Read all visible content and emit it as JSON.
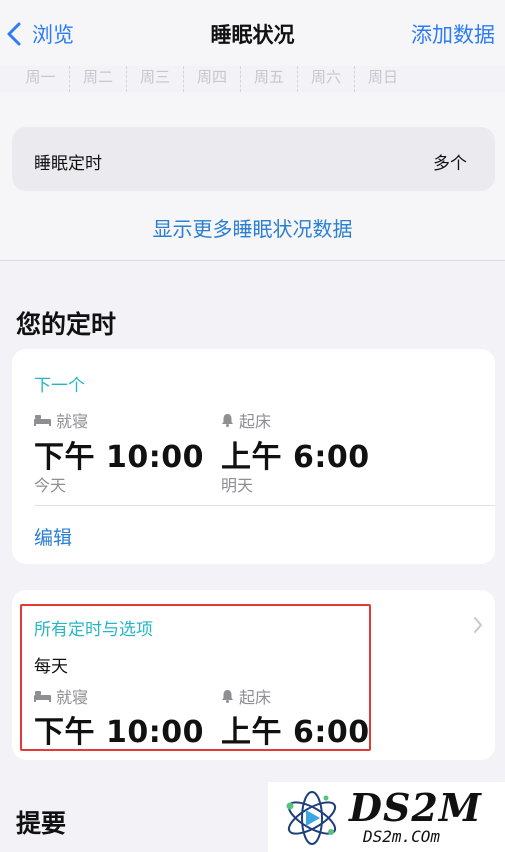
{
  "nav": {
    "back_label": "浏览",
    "title": "睡眠状况",
    "action_label": "添加数据"
  },
  "weekdays": [
    "周一",
    "周二",
    "周三",
    "周四",
    "周五",
    "周六",
    "周日"
  ],
  "sleep_schedule_row": {
    "label": "睡眠定时",
    "value": "多个"
  },
  "show_more_label": "显示更多睡眠状况数据",
  "your_schedule": {
    "title": "您的定时",
    "next": {
      "heading": "下一个",
      "bedtime_label": "就寝",
      "bedtime_time": "下午 10:00",
      "bedtime_day": "今天",
      "wake_label": "起床",
      "wake_time": "上午 6:00",
      "wake_day": "明天",
      "edit_label": "编辑"
    },
    "all": {
      "heading": "所有定时与选项",
      "frequency": "每天",
      "bedtime_label": "就寝",
      "bedtime_time": "下午 10:00",
      "wake_label": "起床",
      "wake_time": "上午 6:00"
    }
  },
  "summary_title": "提要",
  "watermark": {
    "brand": "DS2M",
    "domain": "DS2m.COm"
  },
  "colors": {
    "accent_blue": "#2d7cf6",
    "teal": "#27b6c4",
    "highlight_red": "#e53935",
    "background": "#f2f2f7"
  },
  "icons": {
    "back": "chevron-left-icon",
    "bed": "bed-icon",
    "alarm": "bell-icon",
    "disclosure": "chevron-right-icon"
  }
}
